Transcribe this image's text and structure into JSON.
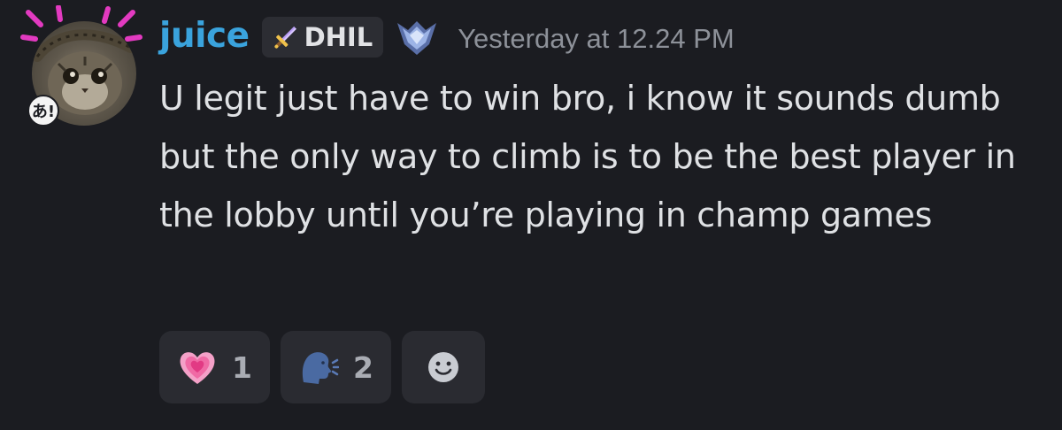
{
  "author": {
    "username": "juice",
    "avatar_icon": "cat-with-snake-avatar",
    "decoration_icon": "sparkle-decoration-icon",
    "badge_icon": "hiragana-a-badge-icon",
    "name_color": "#3aa3dd"
  },
  "guild_tag": {
    "icon": "sword-icon",
    "label": "DHIL"
  },
  "rank_icon": "champion-rank-icon",
  "timestamp": "Yesterday at 12.24 PM",
  "message": {
    "text": "U legit just have to win bro, i know it sounds dumb but the only way to climb is to be the best player in the lobby until you’re playing in champ games"
  },
  "reactions": [
    {
      "emoji_icon": "growing-heart-icon",
      "count": "1"
    },
    {
      "emoji_icon": "speaking-head-icon",
      "count": "2"
    }
  ],
  "add_reaction_icon": "smiley-add-reaction-icon",
  "colors": {
    "background": "#1b1c21",
    "reaction_bg": "#2a2b31",
    "timestamp": "#8d9199",
    "text": "#dfe1e4"
  }
}
